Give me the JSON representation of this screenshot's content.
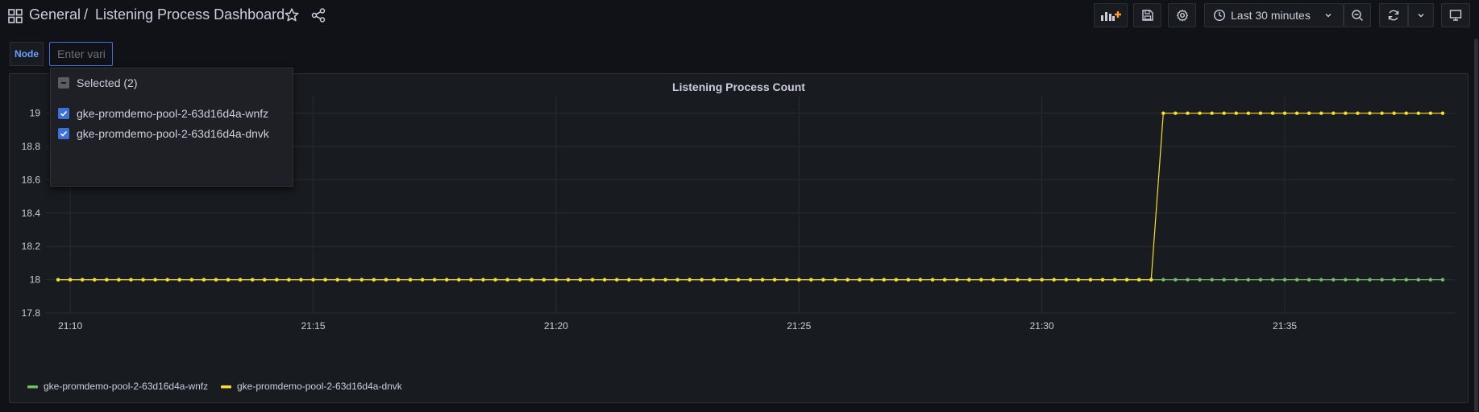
{
  "header": {
    "folder": "General",
    "separator": "/",
    "title": "Listening Process Dashboard",
    "time_range": "Last 30 minutes"
  },
  "variables": {
    "node_label": "Node",
    "input_placeholder": "Enter variable value",
    "dropdown": {
      "selected_label": "Selected (2)",
      "options": [
        {
          "label": "gke-promdemo-pool-2-63d16d4a-wnfz",
          "checked": true
        },
        {
          "label": "gke-promdemo-pool-2-63d16d4a-dnvk",
          "checked": true
        }
      ]
    }
  },
  "colors": {
    "accent": "#3d71d9",
    "series_wnfz": "#73bf69",
    "series_dnvk": "#fade2a",
    "add_panel": "#ff9830"
  },
  "chart_data": {
    "type": "line",
    "title": "Listening Process Count",
    "xlabel": "",
    "ylabel": "",
    "x_ticks": [
      "21:10",
      "21:15",
      "21:20",
      "21:25",
      "21:30",
      "21:35"
    ],
    "y_ticks": [
      "17.8",
      "18",
      "18.2",
      "18.4",
      "18.6",
      "18.8",
      "19"
    ],
    "ylim": [
      17.8,
      19.1
    ],
    "x_range": [
      "21:09:30",
      "21:38:30"
    ],
    "grid": true,
    "legend_position": "bottom-left",
    "series": [
      {
        "name": "gke-promdemo-pool-2-63d16d4a-wnfz",
        "color": "#73bf69",
        "interval_s": 15,
        "points": [
          {
            "from": "21:09:45",
            "to": "21:38:15",
            "value": 18
          }
        ]
      },
      {
        "name": "gke-promdemo-pool-2-63d16d4a-dnvk",
        "color": "#fade2a",
        "interval_s": 15,
        "points": [
          {
            "from": "21:09:45",
            "to": "21:32:15",
            "value": 18
          },
          {
            "from": "21:32:30",
            "to": "21:38:15",
            "value": 19
          }
        ]
      }
    ]
  }
}
